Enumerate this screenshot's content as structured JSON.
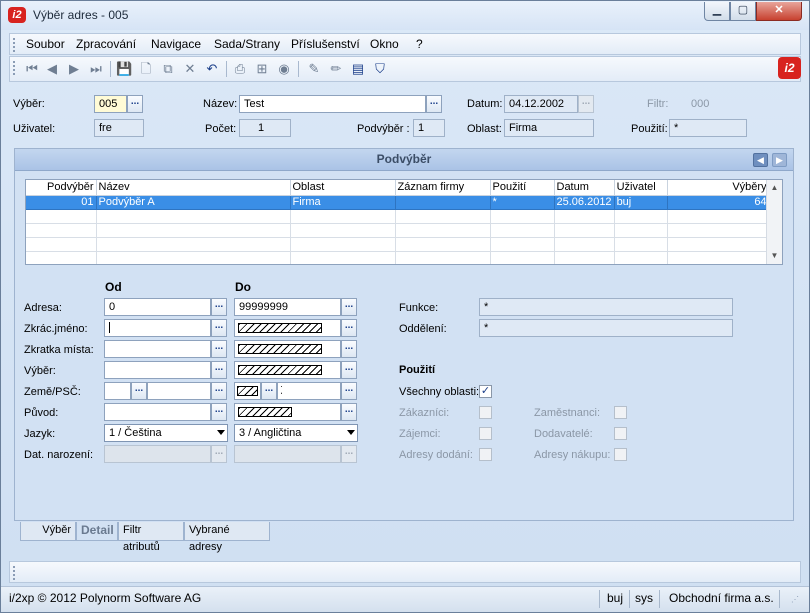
{
  "window": {
    "title": "Výběr adres - 005",
    "logo": "i2"
  },
  "menu": [
    "Soubor",
    "Zpracování",
    "Navigace",
    "Sada/Strany",
    "Příslušenství",
    "Okno",
    "?"
  ],
  "toolbar_icons": [
    "first-icon",
    "prev-icon",
    "next-icon",
    "last-icon",
    "save-icon",
    "new-icon",
    "copy-icon",
    "delete-icon",
    "undo-icon",
    "print-icon",
    "tree-icon",
    "globe-icon",
    "edit-icon",
    "pencil-icon",
    "note-icon",
    "filter-icon"
  ],
  "header": {
    "vyber_label": "Výběr:",
    "vyber_value": "005",
    "nazev_label": "Název:",
    "nazev_value": "Test",
    "datum_label": "Datum:",
    "datum_value": "04.12.2002",
    "filtr_label": "Filtr:",
    "filtr_value": "000",
    "uzivatel_label": "Uživatel:",
    "uzivatel_value": "fre",
    "pocet_label": "Počet:",
    "pocet_value": "1",
    "podvyber_label": "Podvýběr :",
    "podvyber_value": "1",
    "oblast_label": "Oblast:",
    "oblast_value": "Firma",
    "pouziti_label": "Použití:",
    "pouziti_value": "*"
  },
  "panel": {
    "title": "Podvýběr"
  },
  "grid": {
    "columns": [
      "Podvýběr",
      "Název",
      "Oblast",
      "Záznam firmy",
      "Použití",
      "Datum",
      "Uživatel",
      "Výběry"
    ],
    "rows": [
      [
        "01",
        "Podvýběr A",
        "Firma",
        "",
        "*",
        "25.06.2012",
        "buj",
        "64"
      ]
    ]
  },
  "detail": {
    "od_header": "Od",
    "do_header": "Do",
    "adresa_label": "Adresa:",
    "adresa_od": "0",
    "adresa_do": "99999999",
    "zkrac_label": "Zkrác.jméno:",
    "zkratka_label": "Zkratka místa:",
    "vyber_label": "Výběr:",
    "zeme_label": "Země/PSČ:",
    "puvod_label": "Původ:",
    "jazyk_label": "Jazyk:",
    "jazyk_od": "1 / Čeština",
    "jazyk_do": "3 / Angličtina",
    "dat_label": "Dat. narození:",
    "funkce_label": "Funkce:",
    "funkce_value": "*",
    "oddeleni_label": "Oddělení:",
    "oddeleni_value": "*",
    "pouziti_header": "Použití",
    "vsechny_label": "Všechny oblasti:",
    "zakaznici_label": "Zákazníci:",
    "zajemci_label": "Zájemci:",
    "adresy_dodani_label": "Adresy dodání:",
    "zamestnanci_label": "Zaměstnanci:",
    "dodavatele_label": "Dodavatelé:",
    "adresy_nakupu_label": "Adresy nákupu:"
  },
  "tabs": [
    "Výběr",
    "Detail",
    "Filtr atributů",
    "Vybrané adresy"
  ],
  "status": {
    "copyright": "i/2xp © 2012 Polynorm Software AG",
    "user": "buj",
    "db": "sys",
    "company": "Obchodní firma a.s."
  }
}
